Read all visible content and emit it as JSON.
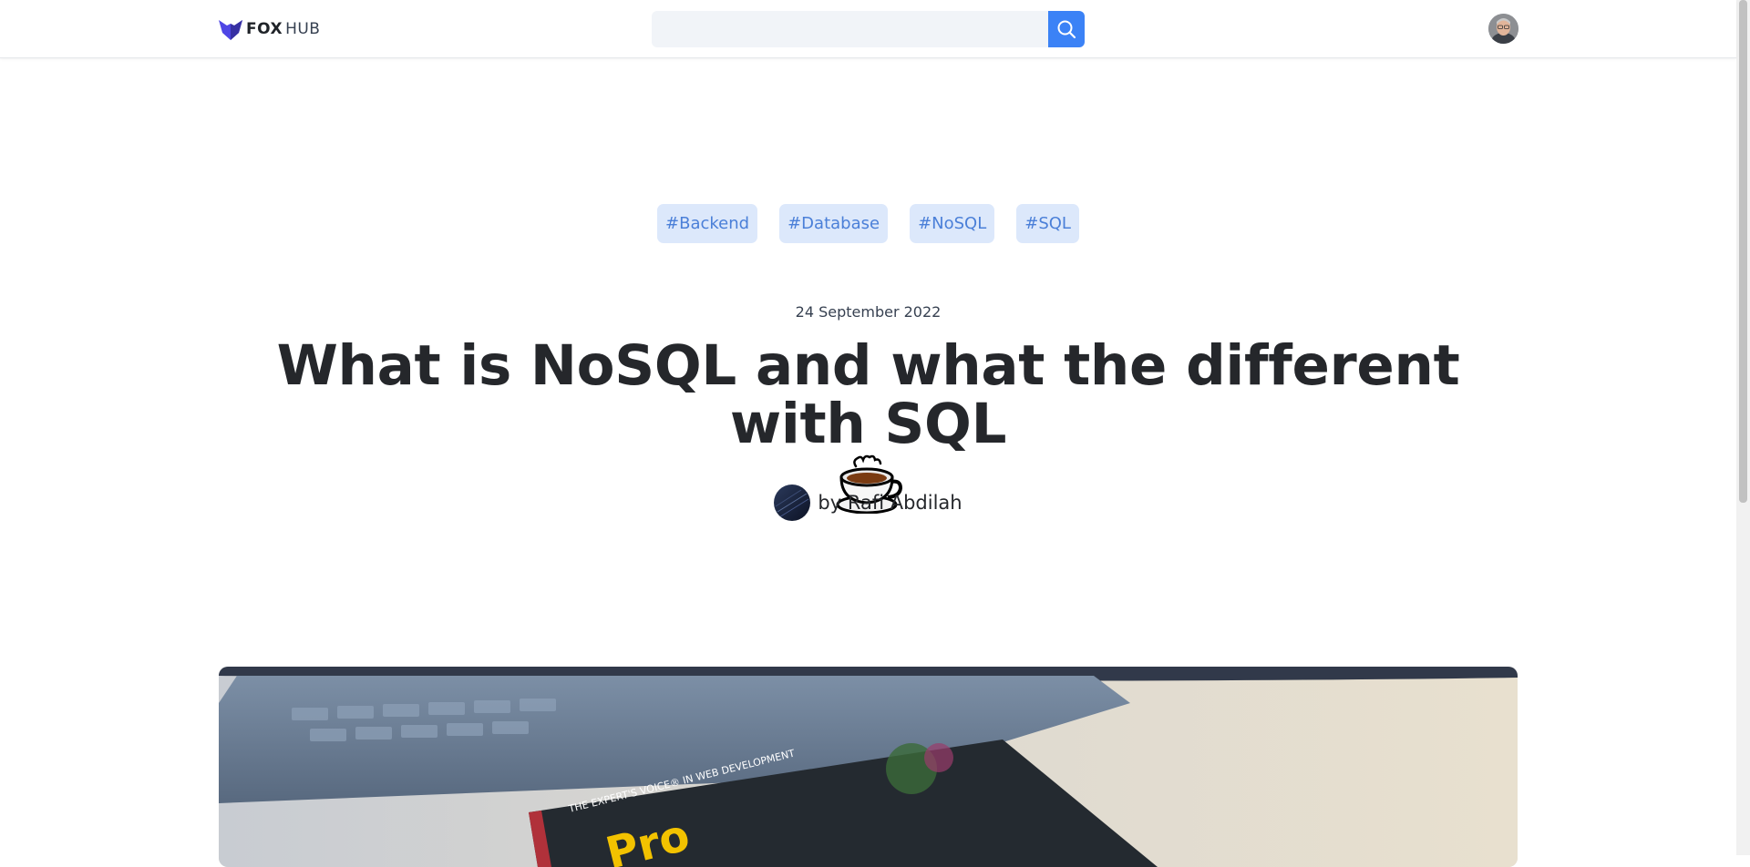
{
  "brand": {
    "bold": "FOX",
    "light": "HUB",
    "logo_icon": "fox-icon",
    "color": "#4f46e5"
  },
  "search": {
    "placeholder": "",
    "value": "",
    "icon": "search-icon",
    "button_color": "#3b82f6"
  },
  "user": {
    "avatar_icon": "avatar"
  },
  "article": {
    "tags": [
      "#Backend",
      "#Database",
      "#NoSQL",
      "#SQL"
    ],
    "date": "24 September 2022",
    "title": "What is NoSQL and what the different with SQL",
    "title_emoji": "teacup-icon",
    "author": "by Rafi Abdilah",
    "author_avatar": "author-avatar",
    "hero_image": {
      "cover_text": "THE EXPERT'S VOICE® IN WEB DEVELOPMENT",
      "title_text": "Pro"
    }
  },
  "colors": {
    "tag_bg": "#dce8fb",
    "tag_text": "#4a7fd8",
    "title": "#25272b"
  }
}
